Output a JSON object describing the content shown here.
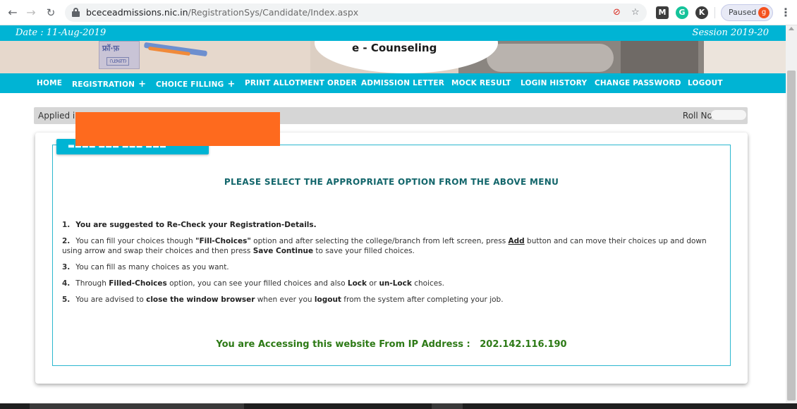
{
  "browser": {
    "url_domain": "bceceadmissions.nic.in",
    "url_path": "/RegistrationSys/Candidate/Index.aspx",
    "paused_label": "Paused",
    "avatar_letter": "g",
    "ext_m": "M",
    "ext_g": "G",
    "ext_k": "K"
  },
  "header": {
    "date": "Date : 11-Aug-2019",
    "session": "Session 2019-20",
    "title": "e - Counseling"
  },
  "menu": {
    "home": "HOME",
    "registration": "REGISTRATION",
    "choice_filling": "CHOICE FILLING",
    "print_allotment": "PRINT ALLOTMENT ORDER",
    "admission_letter": "ADMISSION LETTER",
    "mock_result": "MOCK RESULT",
    "login_history": "LOGIN HISTORY",
    "change_password": "CHANGE PASSWORD",
    "logout": "LOGOUT",
    "plus": "+"
  },
  "status": {
    "applied_in": "Applied in",
    "roll_no": "Roll No -"
  },
  "card": {
    "headline": "PLEASE SELECT THE APPROPRIATE OPTION FROM THE ABOVE MENU",
    "instructions": {
      "i1": {
        "num": "1.",
        "text": "You are suggested to Re-Check your Registration-Details."
      },
      "i2": {
        "num": "2.",
        "a": "You can fill your choices though ",
        "b": "\"Fill-Choices\"",
        "c": " option and after selecting the college/branch from left screen, press ",
        "d": "Add",
        "e": " button and can move their choices up and down using arrow and swap their choices and then press ",
        "f": "Save Continue",
        "g": " to save your filled choices."
      },
      "i3": {
        "num": "3.",
        "text": "You can fill as many choices as you want."
      },
      "i4": {
        "num": "4.",
        "a": "Through ",
        "b": "Filled-Choices",
        "c": " option, you can see your filled choices and also ",
        "d": "Lock",
        "e": " or ",
        "f": "un-Lock",
        "g": " choices."
      },
      "i5": {
        "num": "5.",
        "a": "You are advised to ",
        "b": "close the window browser",
        "c": " when ever you ",
        "d": "logout",
        "e": " from the system after completing your job."
      }
    },
    "ip_line": "You are Accessing this website From IP Address :   202.142.116.190"
  },
  "colors": {
    "teal": "#00b4d4",
    "headline": "#13666b",
    "ip_green": "#2d7a16",
    "redaction": "#fe6a1e"
  }
}
